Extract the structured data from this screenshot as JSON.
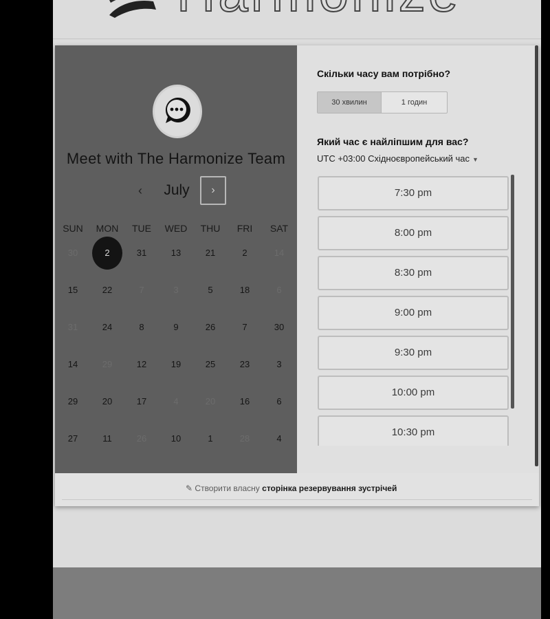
{
  "brand": {
    "name": "Harmonize"
  },
  "calendar": {
    "title": "Meet with The Harmonize Team",
    "month": "July",
    "prev_icon": "‹",
    "next_icon": "›",
    "weekdays": [
      "SUN",
      "MON",
      "TUE",
      "WED",
      "THU",
      "FRI",
      "SAT"
    ],
    "weeks": [
      [
        {
          "d": "30",
          "dim": true
        },
        {
          "d": "2",
          "sel": true
        },
        {
          "d": "31"
        },
        {
          "d": "13"
        },
        {
          "d": "21"
        },
        {
          "d": "2"
        },
        {
          "d": "14",
          "dim": true
        }
      ],
      [
        {
          "d": "15"
        },
        {
          "d": "22"
        },
        {
          "d": "7",
          "dim": true
        },
        {
          "d": "3",
          "dim": true
        },
        {
          "d": "5"
        },
        {
          "d": "18"
        },
        {
          "d": "6",
          "dim": true
        }
      ],
      [
        {
          "d": "31",
          "dim": true
        },
        {
          "d": "24"
        },
        {
          "d": "8"
        },
        {
          "d": "9"
        },
        {
          "d": "26"
        },
        {
          "d": "7"
        },
        {
          "d": "30"
        }
      ],
      [
        {
          "d": "14"
        },
        {
          "d": "29",
          "dim": true
        },
        {
          "d": "12"
        },
        {
          "d": "19"
        },
        {
          "d": "25"
        },
        {
          "d": "23"
        },
        {
          "d": "3"
        }
      ],
      [
        {
          "d": "29"
        },
        {
          "d": "20"
        },
        {
          "d": "17"
        },
        {
          "d": "4",
          "dim": true
        },
        {
          "d": "20",
          "dim": true
        },
        {
          "d": "16"
        },
        {
          "d": "6"
        }
      ],
      [
        {
          "d": "27"
        },
        {
          "d": "11"
        },
        {
          "d": "26",
          "dim": true
        },
        {
          "d": "10"
        },
        {
          "d": "1"
        },
        {
          "d": "28",
          "dim": true
        },
        {
          "d": "4"
        }
      ]
    ]
  },
  "booking": {
    "duration_question": "Скільки часу вам потрібно?",
    "durations": [
      "30 хвилин",
      "1 годин"
    ],
    "selected_duration": "30 хвилин",
    "time_question": "Який час є найліпшим для вас?",
    "timezone": "UTC +03:00 Східноєвропейський час",
    "slots": [
      "7:30 pm",
      "8:00 pm",
      "8:30 pm",
      "9:00 pm",
      "9:30 pm",
      "10:00 pm",
      "10:30 pm"
    ]
  },
  "footer": {
    "icon": "pencil-icon",
    "prefix": "Створити власну",
    "link_text": "сторінка резервування зустрічей"
  },
  "colors": {
    "page_bg": "#dcdcdc",
    "left_panel": "#5e5e5e",
    "selected_day": "#141414",
    "outer_bg": "#000000"
  }
}
